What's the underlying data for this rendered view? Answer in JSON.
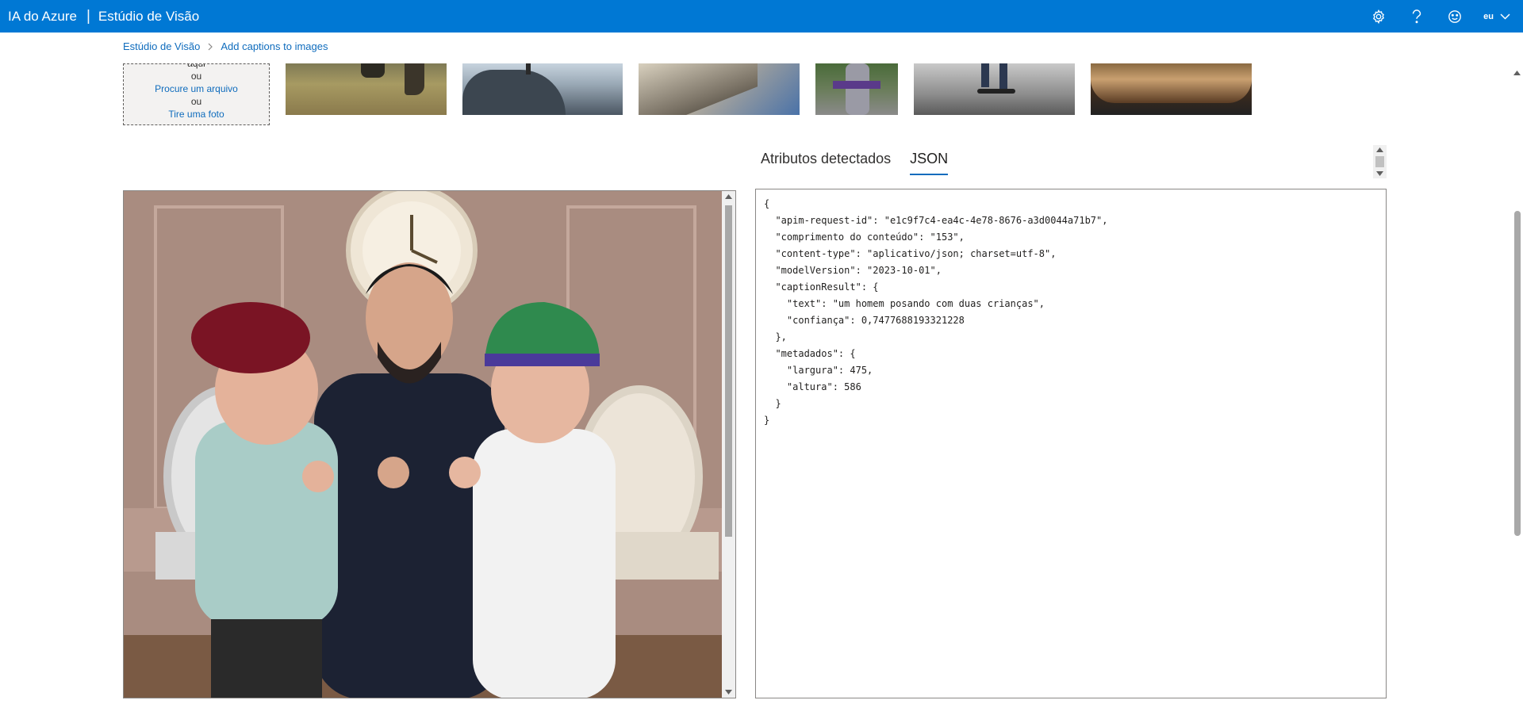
{
  "header": {
    "brand": "IA do Azure",
    "separator": "|",
    "app_title": "Estúdio de Visão",
    "user_label": "eu",
    "icons": [
      "settings-icon",
      "help-icon",
      "feedback-smiley-icon",
      "chevron-down-icon"
    ]
  },
  "breadcrumb": {
    "home": "Estúdio de Visão",
    "current": "Add captions to images"
  },
  "upload": {
    "clipped_text": "aqui",
    "or1": "ou",
    "browse": "Procure um arquivo",
    "or2": "ou",
    "photo": "Tire uma foto"
  },
  "tabs": [
    {
      "label": "Atributos detectados",
      "active": false
    },
    {
      "label": "JSON",
      "active": true
    }
  ],
  "json_output": "{\n  \"apim-request-id\": \"e1c9f7c4-ea4c-4e78-8676-a3d0044a71b7\",\n  \"comprimento do conteúdo\": \"153\",\n  \"content-type\": \"aplicativo/json; charset=utf-8\",\n  \"modelVersion\": \"2023-10-01\",\n  \"captionResult\": {\n    \"text\": \"um homem posando com duas crianças\",\n    \"confiança\": 0,7477688193321228\n  },\n  \"metadados\": {\n    \"largura\": 475,\n    \"altura\": 586\n  }\n}",
  "colors": {
    "header_bg": "#0078d4",
    "link": "#0f6cbd",
    "tab_underline": "#0f6cbd"
  }
}
